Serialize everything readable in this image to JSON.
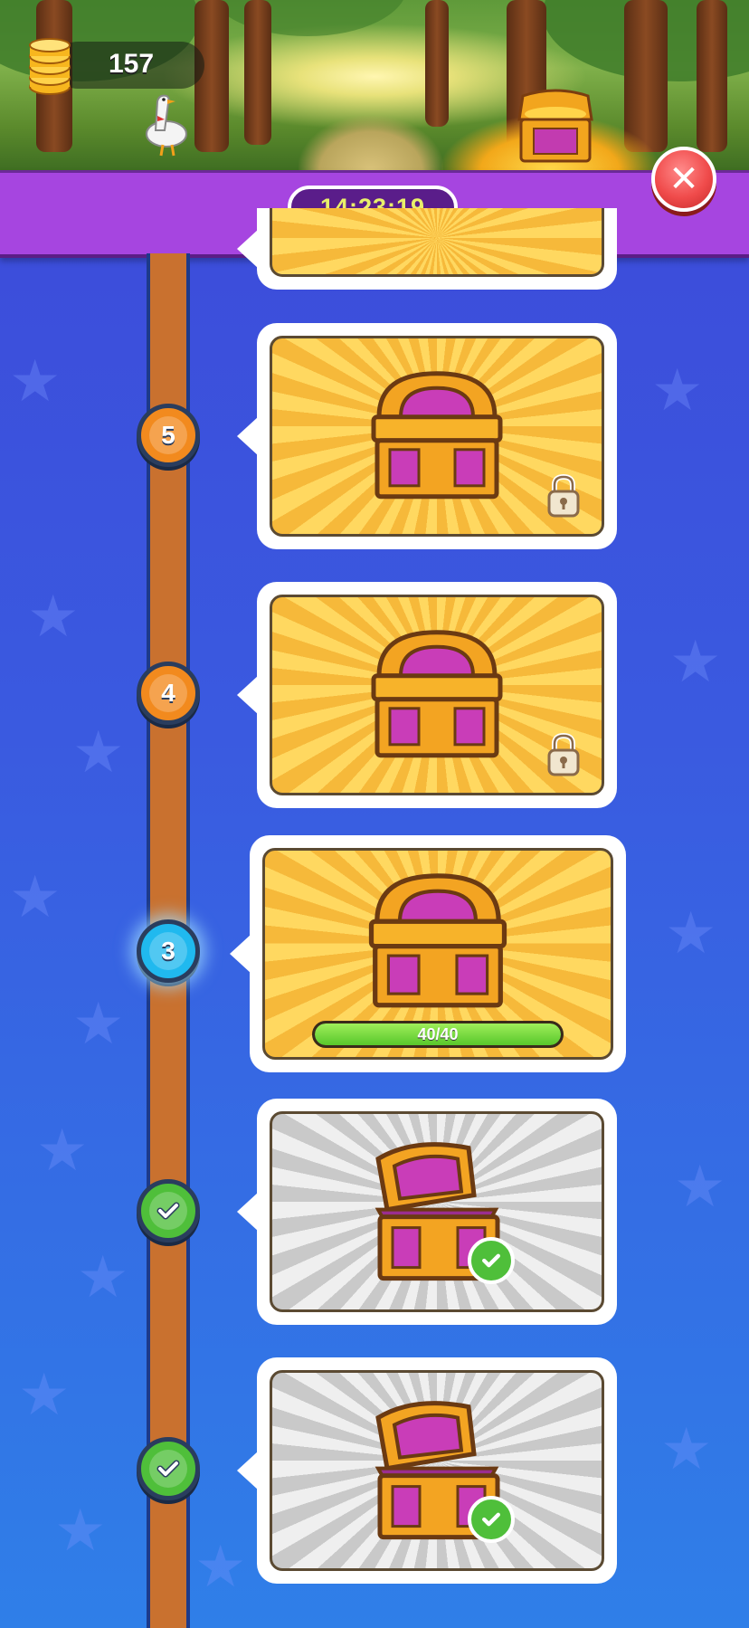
{
  "header": {
    "coin_count": "157",
    "timer": "14:23:19",
    "close_icon": "close-icon",
    "coin_icon": "coin-stack-icon"
  },
  "colors": {
    "timer_bar": "#a645e0",
    "close_button": "#f04b4b",
    "rail": "#c9712f",
    "node_locked": "#f28a1e",
    "node_current": "#20b9ef",
    "node_done": "#4fbf3a"
  },
  "milestones": [
    {
      "level": "5",
      "state": "locked",
      "icon": "lock-icon"
    },
    {
      "level": "4",
      "state": "locked",
      "icon": "lock-icon"
    },
    {
      "level": "3",
      "state": "current",
      "progress_text": "40/40",
      "progress_fraction": 1.0
    },
    {
      "level": "",
      "state": "completed",
      "icon": "checkmark-icon"
    },
    {
      "level": "",
      "state": "completed",
      "icon": "checkmark-icon"
    }
  ]
}
